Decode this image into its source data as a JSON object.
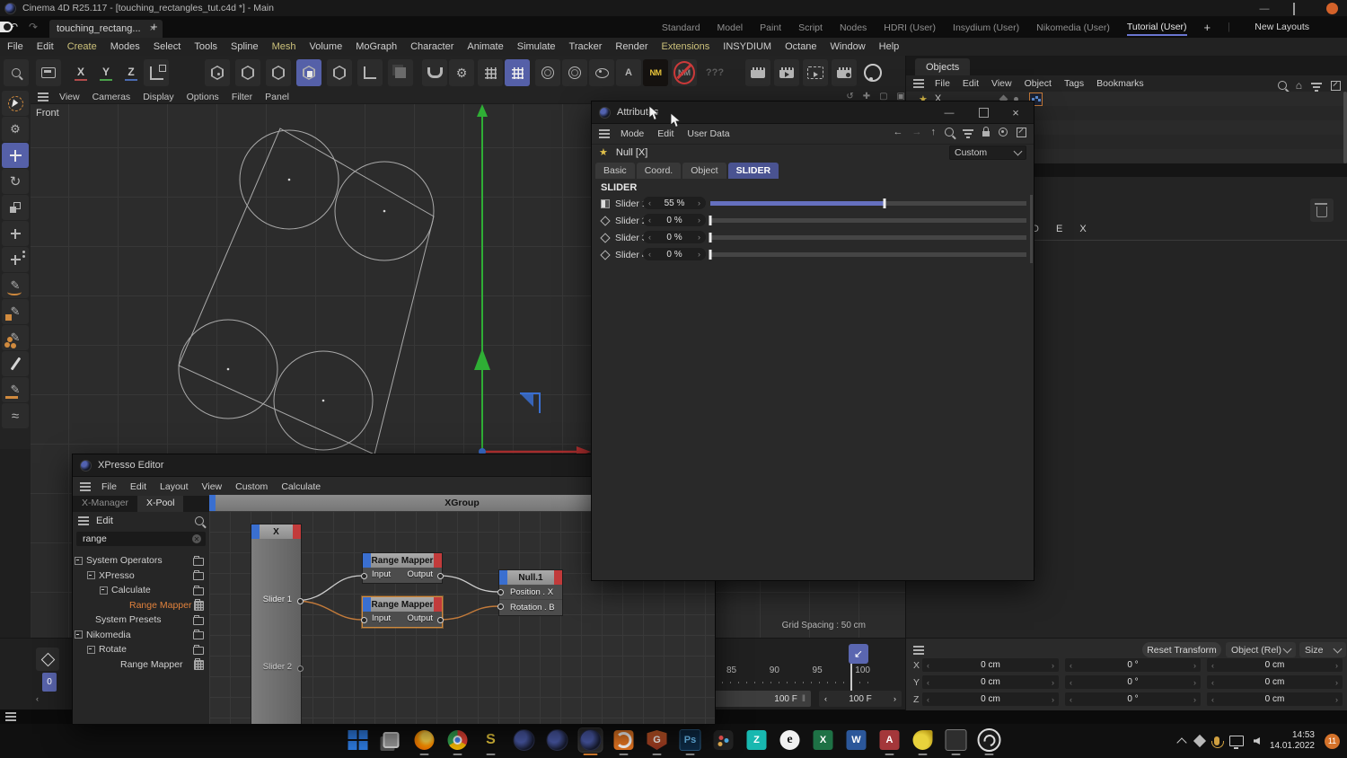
{
  "titlebar": {
    "title": "Cinema 4D R25.117 - [touching_rectangles_tut.c4d *] - Main"
  },
  "tabbar": {
    "doc_tab": "touching_rectang...",
    "layouts": [
      {
        "label": "Standard",
        "active": false
      },
      {
        "label": "Model",
        "active": false
      },
      {
        "label": "Paint",
        "active": false
      },
      {
        "label": "Script",
        "active": false
      },
      {
        "label": "Nodes",
        "active": false
      },
      {
        "label": "HDRI (User)",
        "active": false
      },
      {
        "label": "Insydium (User)",
        "active": false
      },
      {
        "label": "Nikomedia (User)",
        "active": false
      },
      {
        "label": "Tutorial (User)",
        "active": true
      }
    ],
    "new_layouts_label": "New Layouts"
  },
  "menubar": {
    "items": [
      {
        "label": "File"
      },
      {
        "label": "Edit"
      },
      {
        "label": "Create",
        "accent": true
      },
      {
        "label": "Modes"
      },
      {
        "label": "Select"
      },
      {
        "label": "Tools"
      },
      {
        "label": "Spline"
      },
      {
        "label": "Mesh",
        "accent": true
      },
      {
        "label": "Volume"
      },
      {
        "label": "MoGraph"
      },
      {
        "label": "Character"
      },
      {
        "label": "Animate"
      },
      {
        "label": "Simulate"
      },
      {
        "label": "Tracker"
      },
      {
        "label": "Render"
      },
      {
        "label": "Extensions",
        "accent": true
      },
      {
        "label": "INSYDIUM"
      },
      {
        "label": "Octane"
      },
      {
        "label": "Window"
      },
      {
        "label": "Help"
      }
    ]
  },
  "viewport": {
    "menu": [
      {
        "label": "View"
      },
      {
        "label": "Cameras"
      },
      {
        "label": "Display"
      },
      {
        "label": "Options"
      },
      {
        "label": "Filter"
      },
      {
        "label": "Panel"
      }
    ],
    "label": "Front",
    "grid_spacing": "Grid Spacing : 50 cm"
  },
  "attributes": {
    "title": "Attributes",
    "menu": [
      {
        "label": "Mode"
      },
      {
        "label": "Edit"
      },
      {
        "label": "User Data"
      }
    ],
    "object_name": "Null [X]",
    "preset": "Custom",
    "tabs": [
      {
        "label": "Basic",
        "active": false
      },
      {
        "label": "Coord.",
        "active": false
      },
      {
        "label": "Object",
        "active": false
      },
      {
        "label": "SLIDER",
        "active": true
      }
    ],
    "section_title": "SLIDER",
    "sliders": [
      {
        "name": "Slider 1",
        "value": "55 %",
        "percent": 55,
        "diamond": false
      },
      {
        "name": "Slider 2",
        "value": "0 %",
        "percent": 0,
        "diamond": true
      },
      {
        "name": "Slider 3",
        "value": "0 %",
        "percent": 0,
        "diamond": true
      },
      {
        "name": "Slider 4",
        "value": "0 %",
        "percent": 0,
        "diamond": true
      }
    ]
  },
  "xpresso": {
    "title": "XPresso Editor",
    "menu": [
      {
        "label": "File"
      },
      {
        "label": "Edit"
      },
      {
        "label": "Layout"
      },
      {
        "label": "View"
      },
      {
        "label": "Custom"
      },
      {
        "label": "Calculate"
      }
    ],
    "tabs": [
      {
        "label": "X-Manager",
        "active": false
      },
      {
        "label": "X-Pool",
        "active": true
      }
    ],
    "group_title": "XGroup",
    "pool_edit_label": "Edit",
    "search_value": "range",
    "tree": [
      {
        "label": "System Operators",
        "pad": 2,
        "exp": true,
        "node": false,
        "hl": false
      },
      {
        "label": "XPresso",
        "pad": 16,
        "exp": true,
        "node": false,
        "hl": false
      },
      {
        "label": "Calculate",
        "pad": 30,
        "exp": true,
        "node": false,
        "hl": false
      },
      {
        "label": "Range Mapper",
        "pad": 50,
        "exp": false,
        "node": true,
        "hl": true
      },
      {
        "label": "System Presets",
        "pad": 12,
        "exp": false,
        "node": false,
        "hl": false
      },
      {
        "label": "Nikomedia",
        "pad": 2,
        "exp": true,
        "node": false,
        "hl": false
      },
      {
        "label": "Rotate",
        "pad": 16,
        "exp": true,
        "node": false,
        "hl": false
      },
      {
        "label": "Range Mapper",
        "pad": 40,
        "exp": false,
        "node": true,
        "hl": false
      }
    ],
    "nodes": {
      "x_title": "X",
      "x_port1": "Slider 1",
      "x_port2": "Slider 2",
      "rm1_title": "Range Mapper",
      "rm1_input": "Input",
      "rm1_output": "Output",
      "rm2_title": "Range Mapper",
      "rm2_input": "Input",
      "rm2_output": "Output",
      "null_title": "Null.1",
      "null_port1": "Position . X",
      "null_port2": "Rotation . B"
    }
  },
  "objects_panel": {
    "tab": "Objects",
    "menu": [
      {
        "label": "File"
      },
      {
        "label": "Edit"
      },
      {
        "label": "View"
      },
      {
        "label": "Object",
        "accent": true
      },
      {
        "label": "Tags"
      },
      {
        "label": "Bookmarks"
      }
    ],
    "object_label": "X",
    "partial_text": "D E X"
  },
  "coordinates": {
    "reset_button": "Reset Transform",
    "mode_select": "Object (Rel)",
    "size_select": "Size",
    "rows": [
      {
        "axis": "X",
        "position": "0 cm",
        "rotation": "0 °",
        "size": "0 cm"
      },
      {
        "axis": "Y",
        "position": "0 cm",
        "rotation": "0 °",
        "size": "0 cm"
      },
      {
        "axis": "Z",
        "position": "0 cm",
        "rotation": "0 °",
        "size": "0 cm"
      }
    ]
  },
  "timeline": {
    "ticks": [
      {
        "label": "85"
      },
      {
        "label": "90"
      },
      {
        "label": "95"
      },
      {
        "label": "100"
      }
    ],
    "frame_total": "100 F",
    "frame_current": "100 F",
    "marker_label": "0",
    "marker_value": "0"
  },
  "taskbar": {
    "time": "14:53",
    "date": "14.01.2022",
    "badge": "11",
    "icons": [
      {
        "kind": "k-start",
        "name": "windows-start",
        "glyph": "",
        "run": false,
        "active": false
      },
      {
        "kind": "k-task",
        "name": "task-view",
        "glyph": "",
        "run": false,
        "active": false
      },
      {
        "kind": "k-firefox",
        "name": "firefox",
        "glyph": "",
        "run": true,
        "active": false
      },
      {
        "kind": "k-chrome",
        "name": "chrome",
        "glyph": "",
        "run": true,
        "active": false
      },
      {
        "kind": "k-s",
        "name": "sublime",
        "glyph": "S",
        "run": true,
        "active": false
      },
      {
        "kind": "k-c4d",
        "name": "cinema4d-1",
        "glyph": "",
        "run": false,
        "active": false
      },
      {
        "kind": "k-c4d",
        "name": "cinema4d-2",
        "glyph": "",
        "run": false,
        "active": false
      },
      {
        "kind": "k-c4d",
        "name": "cinema4d-3",
        "glyph": "",
        "run": true,
        "active": true
      },
      {
        "kind": "k-houdini",
        "name": "houdini",
        "glyph": "",
        "run": true,
        "active": false
      },
      {
        "kind": "k-shield",
        "name": "guard-shield",
        "glyph": "G",
        "run": true,
        "active": false
      },
      {
        "kind": "k-ps",
        "name": "photoshop",
        "glyph": "Ps",
        "run": true,
        "active": false
      },
      {
        "kind": "k-resolve",
        "name": "resolve",
        "glyph": "",
        "run": false,
        "active": false
      },
      {
        "kind": "k-fa",
        "name": "fa-app",
        "glyph": "Z",
        "run": false,
        "active": false
      },
      {
        "kind": "k-e",
        "name": "e-app",
        "glyph": "e",
        "run": false,
        "active": false
      },
      {
        "kind": "k-excel",
        "name": "excel",
        "glyph": "X",
        "run": false,
        "active": false
      },
      {
        "kind": "k-word",
        "name": "word",
        "glyph": "W",
        "run": false,
        "active": false
      },
      {
        "kind": "k-access",
        "name": "access",
        "glyph": "A",
        "run": true,
        "active": false
      },
      {
        "kind": "k-sketch",
        "name": "sketch-app",
        "glyph": "",
        "run": true,
        "active": false
      },
      {
        "kind": "k-mag",
        "name": "screen-magnifier",
        "glyph": "",
        "run": true,
        "active": false
      },
      {
        "kind": "k-obs",
        "name": "obs",
        "glyph": "",
        "run": true,
        "active": false
      }
    ]
  }
}
